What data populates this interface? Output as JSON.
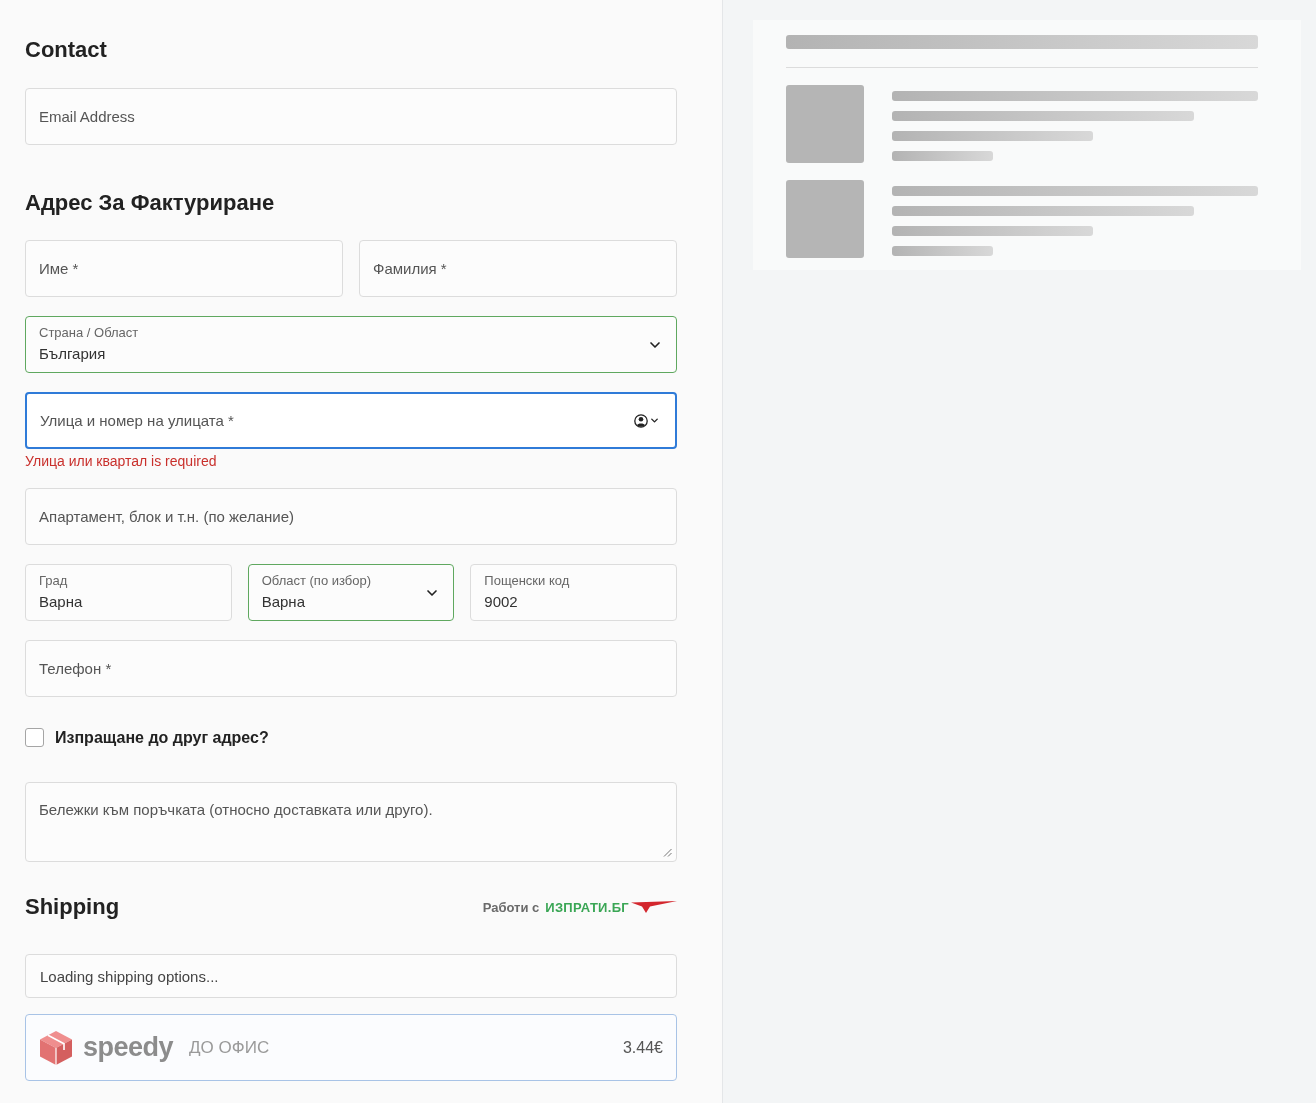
{
  "contact": {
    "heading": "Contact",
    "email": {
      "placeholder": "Email Address"
    }
  },
  "billing": {
    "heading": "Адрес За Фактуриране",
    "rows": [
      [
        {
          "kind": "text",
          "placeholder": "Име *",
          "valid": false,
          "focused": false
        },
        {
          "kind": "text",
          "placeholder": "Фамилия *",
          "valid": false,
          "focused": false
        }
      ],
      [
        {
          "kind": "select",
          "label": "Страна / Област",
          "value": "България",
          "valid": true,
          "focused": false
        }
      ],
      [
        {
          "kind": "address",
          "placeholder": "Улица и номер на улицата *",
          "valid": false,
          "focused": true,
          "error": "Улица или квартал is required"
        }
      ],
      [
        {
          "kind": "text",
          "placeholder": "Апартамент, блок и т.н. (по желание)",
          "valid": false,
          "focused": false
        }
      ],
      [
        {
          "kind": "text",
          "label": "Град",
          "value": "Варна",
          "valid": false,
          "focused": false
        },
        {
          "kind": "select",
          "label": "Област (по избор)",
          "value": "Варна",
          "valid": true,
          "focused": false
        },
        {
          "kind": "text",
          "label": "Пощенски код",
          "value": "9002",
          "valid": false,
          "focused": false
        }
      ],
      [
        {
          "kind": "text",
          "placeholder": "Телефон *",
          "valid": false,
          "focused": false
        }
      ]
    ]
  },
  "ship_to_different_address": {
    "label": "Изпращане до друг адрес?",
    "checked": false
  },
  "order_notes": {
    "placeholder": "Бележки към поръчката (относно доставката или друго)."
  },
  "shipping": {
    "heading": "Shipping",
    "provider_prefix": "Работи с",
    "provider_name": "ИЗПРАТИ.БГ",
    "status": "Loading shipping options...",
    "options": [
      {
        "carrier": "speedy",
        "service": "ДО ОФИС",
        "price": "3.44€",
        "selected": true
      }
    ]
  },
  "order_summary": {
    "loading": true
  }
}
